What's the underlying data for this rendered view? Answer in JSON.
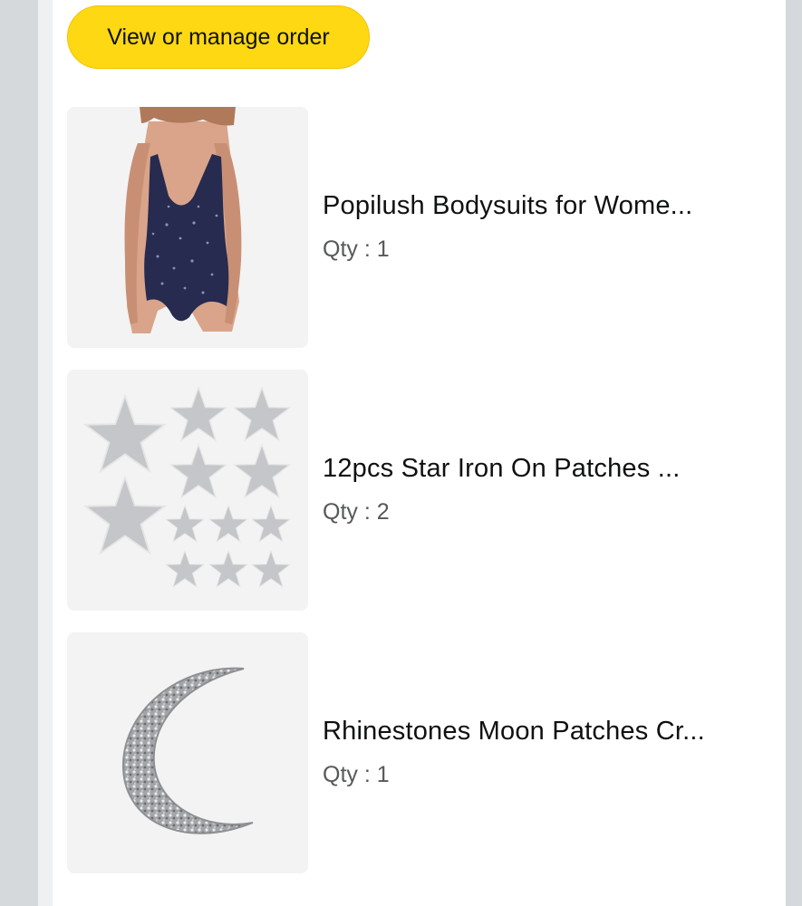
{
  "order": {
    "manage_button_label": "View or manage order",
    "button_color": "#ffd814"
  },
  "items": [
    {
      "title": "Popilush Bodysuits for Wome...",
      "qty": "Qty : 1",
      "image_icon": "bodysuit-product-image"
    },
    {
      "title": "12pcs Star Iron On Patches ...",
      "qty": "Qty : 2",
      "image_icon": "star-patches-product-image"
    },
    {
      "title": "Rhinestones Moon Patches Cr...",
      "qty": "Qty : 1",
      "image_icon": "moon-patch-product-image"
    }
  ]
}
